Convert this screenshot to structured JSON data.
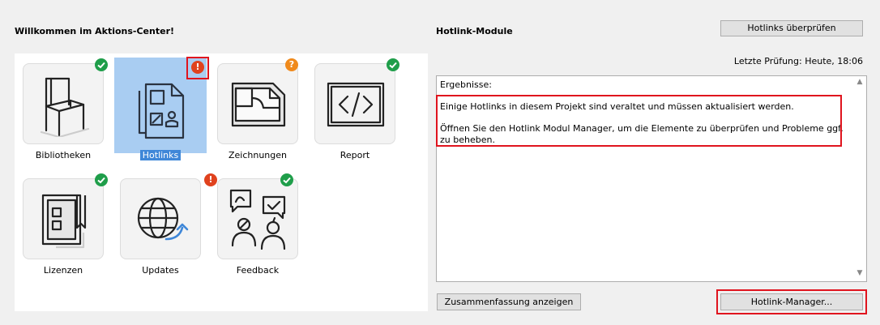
{
  "left_panel": {
    "title": "Willkommen im Aktions-Center!",
    "tiles": [
      {
        "label": "Bibliotheken",
        "icon": "chair-icon",
        "status": "ok"
      },
      {
        "label": "Hotlinks",
        "icon": "hotlinks-icon",
        "status": "error",
        "selected": true
      },
      {
        "label": "Zeichnungen",
        "icon": "drawings-icon",
        "status": "question"
      },
      {
        "label": "Report",
        "icon": "code-report-icon",
        "status": "ok"
      },
      {
        "label": "Lizenzen",
        "icon": "license-icon",
        "status": "ok"
      },
      {
        "label": "Updates",
        "icon": "globe-update-icon",
        "status": "error"
      },
      {
        "label": "Feedback",
        "icon": "feedback-icon",
        "status": "ok"
      }
    ]
  },
  "right_panel": {
    "title": "Hotlink-Module",
    "check_button": "Hotlinks überprüfen",
    "last_check": "Letzte Prüfung: Heute, 18:06",
    "results_label": "Ergebnisse:",
    "message_line1": "Einige Hotlinks in diesem Projekt sind veraltet und müssen aktualisiert werden.",
    "message_line2": "Öffnen Sie den Hotlink Modul Manager, um die Elemente zu überprüfen und Probleme ggf. zu beheben.",
    "summary_button": "Zusammenfassung anzeigen",
    "manager_button": "Hotlink-Manager..."
  },
  "colors": {
    "ok": "#1f9e4a",
    "error": "#e0421e",
    "question": "#f08a1c",
    "highlight": "#e0141e",
    "selection": "#a9cdf2",
    "selection_label": "#3f87d8"
  }
}
